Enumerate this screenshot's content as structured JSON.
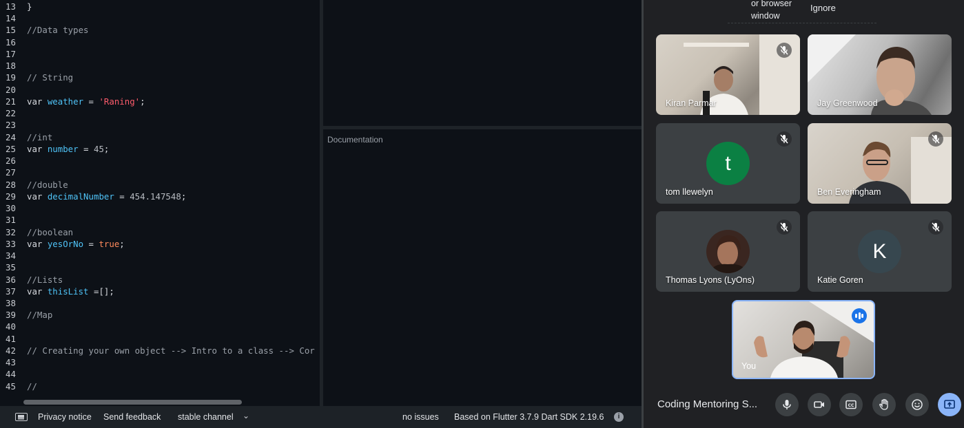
{
  "editor": {
    "lines": [
      {
        "n": "13",
        "tokens": [
          {
            "t": "}",
            "c": "plain"
          }
        ]
      },
      {
        "n": "14",
        "tokens": []
      },
      {
        "n": "15",
        "tokens": [
          {
            "t": "//Data types",
            "c": "comment"
          }
        ]
      },
      {
        "n": "16",
        "tokens": []
      },
      {
        "n": "17",
        "tokens": []
      },
      {
        "n": "18",
        "tokens": []
      },
      {
        "n": "19",
        "tokens": [
          {
            "t": "// String",
            "c": "comment"
          }
        ]
      },
      {
        "n": "20",
        "tokens": []
      },
      {
        "n": "21",
        "tokens": [
          {
            "t": "var ",
            "c": "kw"
          },
          {
            "t": "weather",
            "c": "var"
          },
          {
            "t": " = ",
            "c": "plain"
          },
          {
            "t": "'Raning'",
            "c": "str"
          },
          {
            "t": ";",
            "c": "plain"
          }
        ]
      },
      {
        "n": "22",
        "tokens": []
      },
      {
        "n": "23",
        "tokens": []
      },
      {
        "n": "24",
        "tokens": [
          {
            "t": "//int",
            "c": "comment"
          }
        ]
      },
      {
        "n": "25",
        "tokens": [
          {
            "t": "var ",
            "c": "kw"
          },
          {
            "t": "number",
            "c": "var"
          },
          {
            "t": " = ",
            "c": "plain"
          },
          {
            "t": "45",
            "c": "num"
          },
          {
            "t": ";",
            "c": "plain"
          }
        ]
      },
      {
        "n": "26",
        "tokens": []
      },
      {
        "n": "27",
        "tokens": []
      },
      {
        "n": "28",
        "tokens": [
          {
            "t": "//double",
            "c": "comment"
          }
        ]
      },
      {
        "n": "29",
        "tokens": [
          {
            "t": "var ",
            "c": "kw"
          },
          {
            "t": "decimalNumber",
            "c": "var"
          },
          {
            "t": " = ",
            "c": "plain"
          },
          {
            "t": "454.147548",
            "c": "num"
          },
          {
            "t": ";",
            "c": "plain"
          }
        ]
      },
      {
        "n": "30",
        "tokens": []
      },
      {
        "n": "31",
        "tokens": []
      },
      {
        "n": "32",
        "tokens": [
          {
            "t": "//boolean",
            "c": "comment"
          }
        ]
      },
      {
        "n": "33",
        "tokens": [
          {
            "t": "var ",
            "c": "kw"
          },
          {
            "t": "yesOrNo",
            "c": "var"
          },
          {
            "t": " = ",
            "c": "plain"
          },
          {
            "t": "true",
            "c": "bool"
          },
          {
            "t": ";",
            "c": "plain"
          }
        ]
      },
      {
        "n": "34",
        "tokens": []
      },
      {
        "n": "35",
        "tokens": []
      },
      {
        "n": "36",
        "tokens": [
          {
            "t": "//Lists",
            "c": "comment"
          }
        ]
      },
      {
        "n": "37",
        "tokens": [
          {
            "t": "var ",
            "c": "kw"
          },
          {
            "t": "thisList",
            "c": "var"
          },
          {
            "t": " =[];",
            "c": "plain"
          }
        ]
      },
      {
        "n": "38",
        "tokens": []
      },
      {
        "n": "39",
        "tokens": [
          {
            "t": "//Map",
            "c": "comment"
          }
        ]
      },
      {
        "n": "40",
        "tokens": []
      },
      {
        "n": "41",
        "tokens": []
      },
      {
        "n": "42",
        "tokens": [
          {
            "t": "// Creating your own object --> Intro to a class --> Cor",
            "c": "comment"
          }
        ]
      },
      {
        "n": "43",
        "tokens": []
      },
      {
        "n": "44",
        "tokens": []
      },
      {
        "n": "45",
        "tokens": [
          {
            "t": "//",
            "c": "comment"
          }
        ]
      }
    ]
  },
  "docs": {
    "title": "Documentation"
  },
  "statusbar": {
    "privacy": "Privacy notice",
    "feedback": "Send feedback",
    "channel": "stable channel",
    "chevron": "⌄",
    "issues": "no issues",
    "sdk": "Based on Flutter 3.7.9 Dart SDK 2.19.6",
    "info": "i"
  },
  "meet": {
    "popup": {
      "text": "or browser window",
      "ignore": "Ignore"
    },
    "participants": [
      {
        "name": "Kiran Parmar",
        "video": true
      },
      {
        "name": "Jay Greenwood",
        "video": true
      },
      {
        "name": "tom llewelyn",
        "initial": "t",
        "avatar_color": "#0b8043"
      },
      {
        "name": "Ben Everingham",
        "video": true
      },
      {
        "name": "Thomas Lyons (LyOns)",
        "video": true
      },
      {
        "name": "Katie Goren",
        "initial": "K",
        "avatar_color": "#37474f"
      }
    ],
    "self": {
      "name": "You"
    },
    "meeting_name": "Coding Mentoring S...",
    "accent": "#8ab4f8"
  }
}
